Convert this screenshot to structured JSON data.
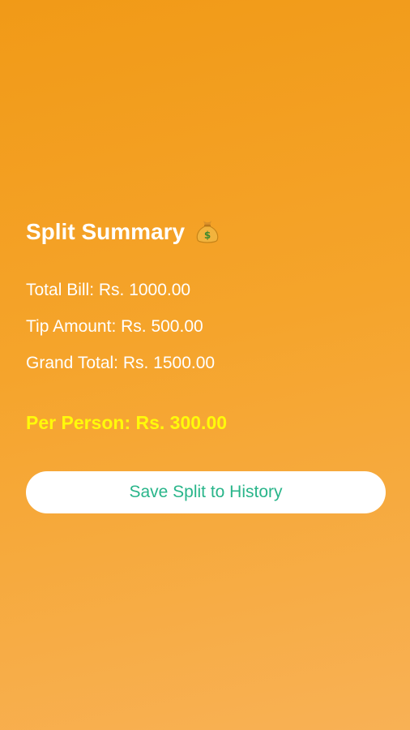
{
  "summary": {
    "title": "Split Summary",
    "title_icon": "money-bag-icon",
    "total_bill": "Total Bill: Rs. 1000.00",
    "tip_amount": "Tip Amount: Rs. 500.00",
    "grand_total": "Grand Total: Rs. 1500.00",
    "per_person": "Per Person: Rs. 300.00"
  },
  "actions": {
    "save_label": "Save Split to History"
  },
  "colors": {
    "background_top": "#f19a17",
    "background_bottom": "#f8b155",
    "per_person_text": "#fffa0a",
    "button_text": "#29b58a",
    "button_background": "#ffffff"
  }
}
